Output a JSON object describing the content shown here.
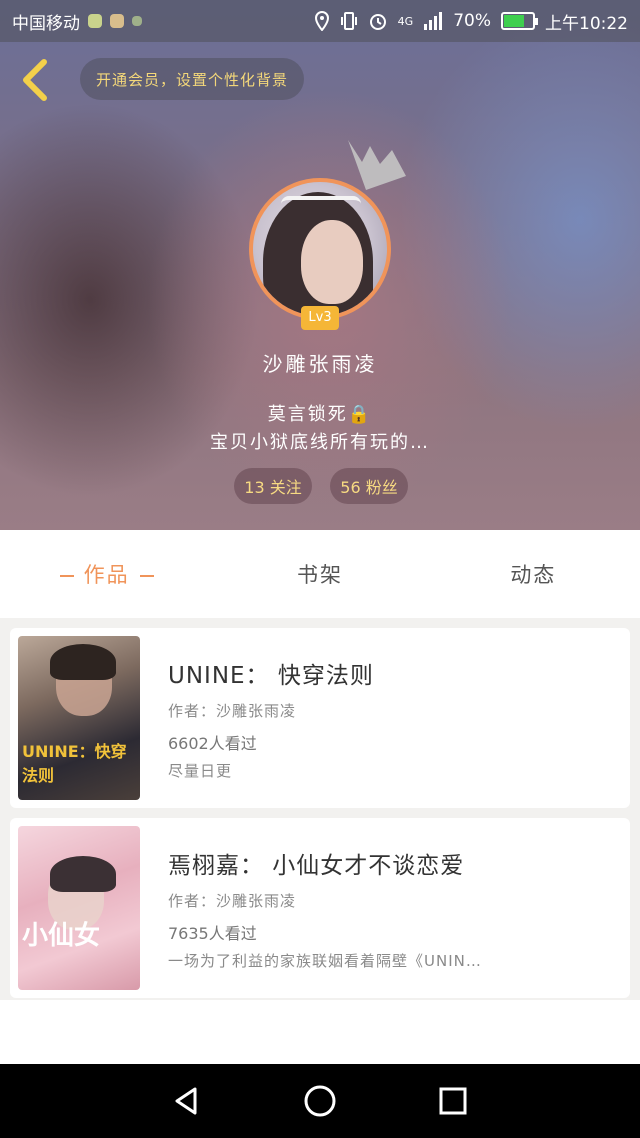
{
  "status_bar": {
    "carrier": "中国移动",
    "network": "4G",
    "battery": "70%",
    "battery_level": 0.7,
    "time": "上午10:22"
  },
  "header": {
    "vip_banner": "开通会员，设置个性化背景",
    "level": "Lv3",
    "username": "沙雕张雨凌",
    "bio_line1": "莫言锁死🔒",
    "bio_line2": "宝贝小狱底线所有玩的…",
    "follow_label": "13 关注",
    "fans_label": "56 粉丝"
  },
  "tabs": [
    {
      "label": "作品",
      "active": true
    },
    {
      "label": "书架",
      "active": false
    },
    {
      "label": "动态",
      "active": false
    }
  ],
  "works": [
    {
      "title": "UNINE： 快穿法则",
      "author": "作者：沙雕张雨凌",
      "reads": "6602人看过",
      "extra": "尽量日更",
      "cover_text": "UNINE：快穿法则"
    },
    {
      "title": "焉栩嘉： 小仙女才不谈恋爱",
      "author": "作者：沙雕张雨凌",
      "reads": "7635人看过",
      "extra": "一场为了利益的家族联姻看着隔壁《UNIN…",
      "cover_text": "小仙女"
    }
  ],
  "colors": {
    "accent": "#f0945a",
    "gold": "#f5b637",
    "vip_text": "#f3d77a"
  }
}
